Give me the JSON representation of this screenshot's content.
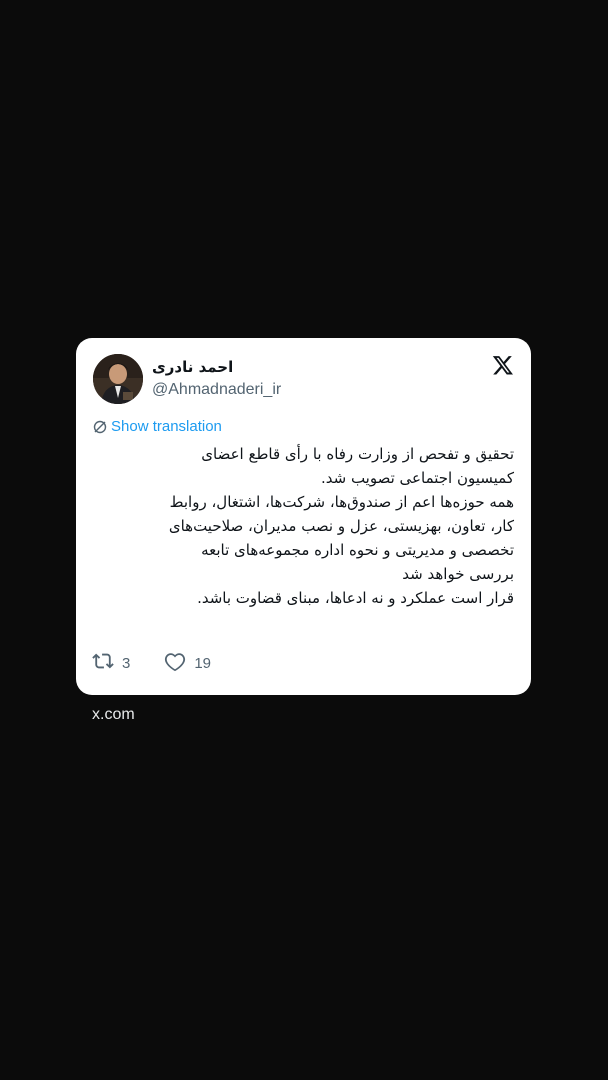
{
  "tweet": {
    "author_name": "احمد نادری",
    "author_handle": "@Ahmadnaderi_ir",
    "translation_label": "Show translation",
    "body_lines": [
      "تحقیق و تفحص از وزارت رفاه با رأی قاطع اعضای",
      "کمیسیون اجتماعی تصویب شد.",
      "همه حوزه‌ها اعم از صندوق‌ها، شرکت‌ها، اشتغال، روابط",
      "کار، تعاون، بهزیستی، عزل و نصب مدیران، صلاحیت‌های",
      "تخصصی و مدیریتی و نحوه اداره مجموعه‌های تابعه",
      "بررسی خواهد شد",
      "قرار است عملکرد و نه ادعاها، مبنای قضاوت باشد."
    ],
    "retweet_count": "3",
    "like_count": "19",
    "icons": {
      "logo": "x-logo-icon",
      "translate": "globe-icon",
      "retweet": "retweet-icon",
      "like": "heart-icon"
    }
  },
  "footer": {
    "source": "x.com"
  }
}
